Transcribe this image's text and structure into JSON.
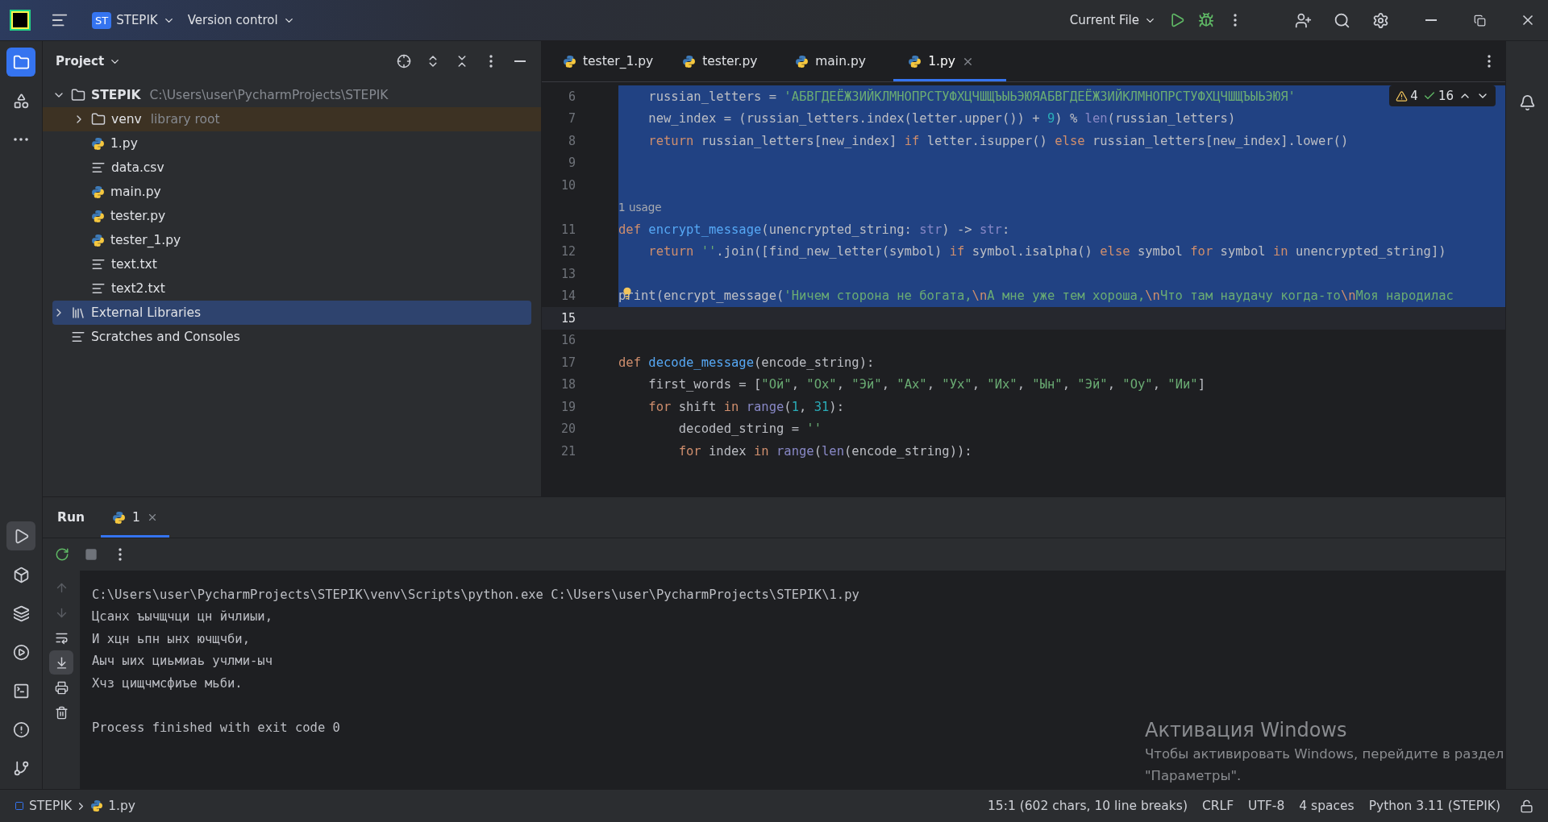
{
  "title_bar": {
    "project_badge": "ST",
    "project": "STEPIK",
    "vcs": "Version control",
    "run_config": "Current File"
  },
  "left_toolbar": {
    "top": [
      {
        "kind": "project",
        "selected": true
      },
      {
        "kind": "structure",
        "selected": false
      },
      {
        "kind": "more",
        "selected": false
      }
    ],
    "bottom": [
      {
        "kind": "run",
        "selected": true
      },
      {
        "kind": "python_console",
        "selected": false
      },
      {
        "kind": "packages",
        "selected": false
      },
      {
        "kind": "services",
        "selected": false
      },
      {
        "kind": "terminal",
        "selected": false
      },
      {
        "kind": "problems",
        "selected": false
      },
      {
        "kind": "git",
        "selected": false
      }
    ]
  },
  "project_panel": {
    "title": "Project",
    "tree": [
      {
        "name": "STEPIK",
        "hint": "C:\\Users\\user\\PycharmProjects\\STEPIK",
        "kind": "root",
        "expanded": true,
        "selected": false,
        "children": [
          {
            "name": "venv",
            "hint": "library root",
            "kind": "library_root",
            "expanded": false,
            "selected": false
          },
          {
            "name": "1.py",
            "kind": "python",
            "selected": false
          },
          {
            "name": "data.csv",
            "kind": "text",
            "selected": false
          },
          {
            "name": "main.py",
            "kind": "python",
            "selected": false
          },
          {
            "name": "tester.py",
            "kind": "python",
            "selected": false
          },
          {
            "name": "tester_1.py",
            "kind": "python",
            "selected": false
          },
          {
            "name": "text.txt",
            "kind": "text",
            "selected": false
          },
          {
            "name": "text2.txt",
            "kind": "text",
            "selected": false
          }
        ]
      },
      {
        "name": "External Libraries",
        "kind": "libraries",
        "expanded": false,
        "selected": true
      },
      {
        "name": "Scratches and Consoles",
        "kind": "scratches",
        "selected": false
      }
    ]
  },
  "editor": {
    "tabs": [
      {
        "label": "tester_1.py",
        "selected": false
      },
      {
        "label": "tester.py",
        "selected": false
      },
      {
        "label": "main.py",
        "selected": false
      },
      {
        "label": "1.py",
        "selected": true
      }
    ],
    "inspections": {
      "warnings": "4",
      "typos": "16"
    },
    "lines": [
      {
        "kind": "code",
        "number": "6",
        "selected": true,
        "current": false,
        "tokens": [
          {
            "kind": "plain",
            "text": "    russian_letters = "
          },
          {
            "kind": "str",
            "text": "'АБВГДЕЁЖЗИЙКЛМНОПРСТУФХЦЧШЩЪЫЬЭЮЯАБВГДЕЁЖЗИЙКЛМНОПРСТУФХЦЧШЩЪЫЬЭЮЯ'"
          }
        ]
      },
      {
        "kind": "code",
        "number": "7",
        "selected": true,
        "current": false,
        "tokens": [
          {
            "kind": "plain",
            "text": "    new_index = (russian_letters.index(letter.upper()) + "
          },
          {
            "kind": "num",
            "text": "9"
          },
          {
            "kind": "plain",
            "text": ") % "
          },
          {
            "kind": "builtin",
            "text": "len"
          },
          {
            "kind": "plain",
            "text": "(russian_letters)"
          }
        ]
      },
      {
        "kind": "code",
        "number": "8",
        "selected": true,
        "current": false,
        "tokens": [
          {
            "kind": "kw",
            "text": "    return"
          },
          {
            "kind": "plain",
            "text": " russian_letters[new_index] "
          },
          {
            "kind": "kw",
            "text": "if"
          },
          {
            "kind": "plain",
            "text": " letter.isupper() "
          },
          {
            "kind": "kw",
            "text": "else"
          },
          {
            "kind": "plain",
            "text": " russian_letters[new_index].lower()"
          }
        ]
      },
      {
        "kind": "code",
        "number": "9",
        "selected": true,
        "current": false
      },
      {
        "kind": "code",
        "number": "10",
        "selected": true,
        "current": false
      },
      {
        "kind": "hint",
        "text": "1 usage",
        "selected": true
      },
      {
        "kind": "code",
        "number": "11",
        "selected": true,
        "current": false,
        "tokens": [
          {
            "kind": "kw",
            "text": "def "
          },
          {
            "kind": "fn",
            "text": "encrypt_message"
          },
          {
            "kind": "plain",
            "text": "(unencrypted_string: "
          },
          {
            "kind": "builtin",
            "text": "str"
          },
          {
            "kind": "plain",
            "text": ") -> "
          },
          {
            "kind": "builtin",
            "text": "str"
          },
          {
            "kind": "plain",
            "text": ":"
          }
        ]
      },
      {
        "kind": "code",
        "number": "12",
        "selected": true,
        "current": false,
        "tokens": [
          {
            "kind": "kw",
            "text": "    return "
          },
          {
            "kind": "str",
            "text": "''"
          },
          {
            "kind": "plain",
            "text": ".join([find_new_letter(symbol) "
          },
          {
            "kind": "kw",
            "text": "if"
          },
          {
            "kind": "plain",
            "text": " symbol.isalpha() "
          },
          {
            "kind": "kw",
            "text": "else"
          },
          {
            "kind": "plain",
            "text": " symbol "
          },
          {
            "kind": "kw",
            "text": "for"
          },
          {
            "kind": "plain",
            "text": " symbol "
          },
          {
            "kind": "kw",
            "text": "in"
          },
          {
            "kind": "plain",
            "text": " unencrypted_string])"
          }
        ]
      },
      {
        "kind": "code",
        "number": "13",
        "selected": true,
        "current": false
      },
      {
        "kind": "code",
        "number": "14",
        "selected": true,
        "current": false,
        "bulb": true,
        "tokens": [
          {
            "kind": "plain",
            "text": "print(encrypt_message("
          },
          {
            "kind": "str",
            "text": "'Ничем сторона не богата,"
          },
          {
            "kind": "esc",
            "text": "\\n"
          },
          {
            "kind": "str",
            "text": "А мне уже тем хороша,"
          },
          {
            "kind": "esc",
            "text": "\\n"
          },
          {
            "kind": "str",
            "text": "Что там наудачу когда-то"
          },
          {
            "kind": "esc",
            "text": "\\n"
          },
          {
            "kind": "str",
            "text": "Моя народилас"
          }
        ]
      },
      {
        "kind": "code",
        "number": "15",
        "selected": false,
        "current": true
      },
      {
        "kind": "code",
        "number": "16",
        "selected": false,
        "current": false
      },
      {
        "kind": "code",
        "number": "17",
        "selected": false,
        "current": false,
        "tokens": [
          {
            "kind": "kw",
            "text": "def "
          },
          {
            "kind": "fn",
            "text": "decode_message"
          },
          {
            "kind": "plain",
            "text": "(encode_string):"
          }
        ]
      },
      {
        "kind": "code",
        "number": "18",
        "selected": false,
        "current": false,
        "tokens": [
          {
            "kind": "plain",
            "text": "    first_words = ["
          },
          {
            "kind": "str",
            "text": "\"Ой\""
          },
          {
            "kind": "plain",
            "text": ", "
          },
          {
            "kind": "str",
            "text": "\"Ох\""
          },
          {
            "kind": "plain",
            "text": ", "
          },
          {
            "kind": "str",
            "text": "\"Эй\""
          },
          {
            "kind": "plain",
            "text": ", "
          },
          {
            "kind": "str",
            "text": "\"Ах\""
          },
          {
            "kind": "plain",
            "text": ", "
          },
          {
            "kind": "str",
            "text": "\"Ух\""
          },
          {
            "kind": "plain",
            "text": ", "
          },
          {
            "kind": "str",
            "text": "\"Их\""
          },
          {
            "kind": "plain",
            "text": ", "
          },
          {
            "kind": "str",
            "text": "\"Ын\""
          },
          {
            "kind": "plain",
            "text": ", "
          },
          {
            "kind": "str",
            "text": "\"Эй\""
          },
          {
            "kind": "plain",
            "text": ", "
          },
          {
            "kind": "str",
            "text": "\"Оу\""
          },
          {
            "kind": "plain",
            "text": ", "
          },
          {
            "kind": "str",
            "text": "\"Ии\""
          },
          {
            "kind": "plain",
            "text": "]"
          }
        ]
      },
      {
        "kind": "code",
        "number": "19",
        "selected": false,
        "current": false,
        "tokens": [
          {
            "kind": "kw",
            "text": "    for"
          },
          {
            "kind": "plain",
            "text": " shift "
          },
          {
            "kind": "kw",
            "text": "in "
          },
          {
            "kind": "builtin",
            "text": "range"
          },
          {
            "kind": "plain",
            "text": "("
          },
          {
            "kind": "num",
            "text": "1"
          },
          {
            "kind": "plain",
            "text": ", "
          },
          {
            "kind": "num",
            "text": "31"
          },
          {
            "kind": "plain",
            "text": "):"
          }
        ]
      },
      {
        "kind": "code",
        "number": "20",
        "selected": false,
        "current": false,
        "tokens": [
          {
            "kind": "plain",
            "text": "        decoded_string = "
          },
          {
            "kind": "str",
            "text": "''"
          }
        ]
      },
      {
        "kind": "code",
        "number": "21",
        "selected": false,
        "current": false,
        "tokens": [
          {
            "kind": "kw",
            "text": "        for"
          },
          {
            "kind": "plain",
            "text": " index "
          },
          {
            "kind": "kw",
            "text": "in "
          },
          {
            "kind": "builtin",
            "text": "range"
          },
          {
            "kind": "plain",
            "text": "("
          },
          {
            "kind": "builtin",
            "text": "len"
          },
          {
            "kind": "plain",
            "text": "(encode_string)):"
          }
        ]
      }
    ]
  },
  "run_panel": {
    "title": "Run",
    "tabs": [
      {
        "label": "1",
        "selected": true
      }
    ],
    "side_tools": [
      {
        "kind": "up",
        "on": false
      },
      {
        "kind": "down",
        "on": false
      },
      {
        "kind": "wrap",
        "on": false
      },
      {
        "kind": "scroll_end",
        "on": true
      },
      {
        "kind": "print",
        "on": false
      },
      {
        "kind": "clear",
        "on": false
      }
    ],
    "output": {
      "command": "C:\\Users\\user\\PycharmProjects\\STEPIK\\venv\\Scripts\\python.exe C:\\Users\\user\\PycharmProjects\\STEPIK\\1.py",
      "lines": [
        "Цсанх ъычщчци цн йчлиыи,",
        "И хцн ьпн ынх ючщчби,",
        "Аыч ыих циьмиаь учлми-ыч",
        "Хчз цищчмсфиъе мьби."
      ],
      "exit": "Process finished with exit code 0"
    }
  },
  "os_overlay": {
    "title": "Активация Windows",
    "lines": [
      "Чтобы активировать Windows, перейдите в раздел",
      "\"Параметры\"."
    ]
  },
  "status_bar": {
    "breadcrumbs": [
      {
        "label": "STEPIK",
        "kind": "module"
      },
      {
        "label": "1.py",
        "kind": "python"
      }
    ],
    "items": [
      "15:1 (602 chars, 10 line breaks)",
      "CRLF",
      "UTF-8",
      "4 spaces",
      "Python 3.11 (STEPIK)"
    ]
  }
}
